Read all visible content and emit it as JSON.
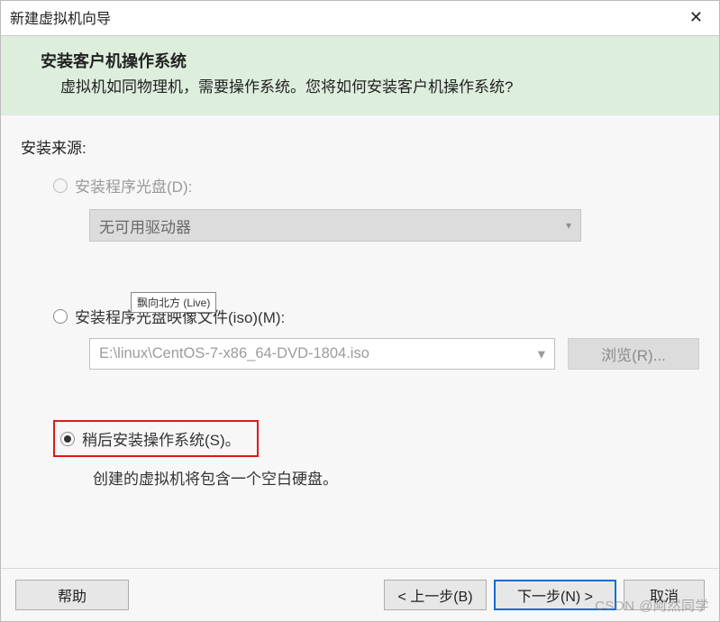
{
  "window": {
    "title": "新建虚拟机向导",
    "close_glyph": "✕"
  },
  "header": {
    "title": "安装客户机操作系统",
    "subtitle": "虚拟机如同物理机，需要操作系统。您将如何安装客户机操作系统?"
  },
  "source": {
    "label": "安装来源:",
    "opt_disc": "安装程序光盘(D):",
    "disc_combo_text": "无可用驱动器",
    "chevron": "▾",
    "opt_iso": "安装程序光盘映像文件(iso)(M):",
    "iso_path": "E:\\linux\\CentOS-7-x86_64-DVD-1804.iso",
    "browse": "浏览(R)...",
    "opt_later": "稍后安装操作系统(S)。",
    "later_note": "创建的虚拟机将包含一个空白硬盘。"
  },
  "tooltip": "飘向北方 (Live)",
  "footer": {
    "help": "帮助",
    "back": "< 上一步(B)",
    "next": "下一步(N) >",
    "cancel": "取消"
  },
  "watermark": "CSDN @阿然同学"
}
